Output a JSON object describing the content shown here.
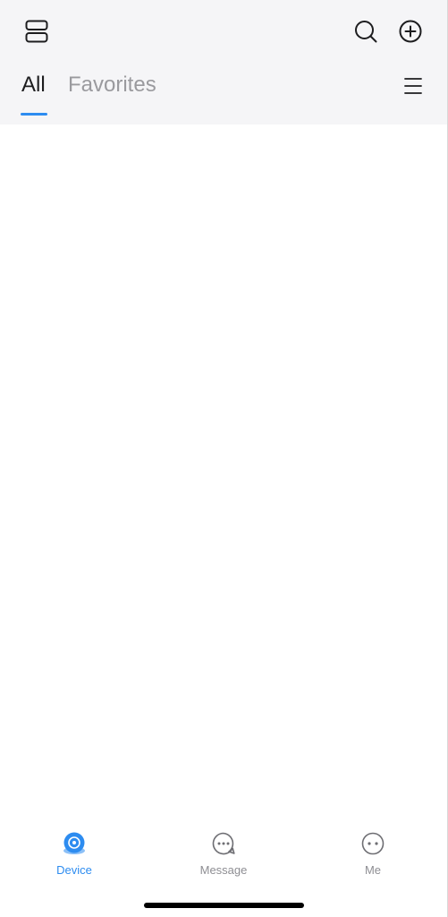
{
  "header": {
    "tabs": [
      {
        "label": "All",
        "active": true
      },
      {
        "label": "Favorites",
        "active": false
      }
    ],
    "icons": {
      "layout": "layout-icon",
      "search": "search-icon",
      "add": "plus-circle-icon",
      "menu": "menu-icon"
    }
  },
  "tabbar": {
    "items": [
      {
        "label": "Device",
        "icon": "camera-icon",
        "active": true
      },
      {
        "label": "Message",
        "icon": "message-icon",
        "active": false
      },
      {
        "label": "Me",
        "icon": "more-icon",
        "active": false
      }
    ]
  },
  "colors": {
    "accent": "#2d8cf0",
    "header_bg": "#f5f5f7",
    "text_primary": "#1d1d1f",
    "text_secondary": "#9a9a9e",
    "tab_inactive": "#8e8e93"
  }
}
